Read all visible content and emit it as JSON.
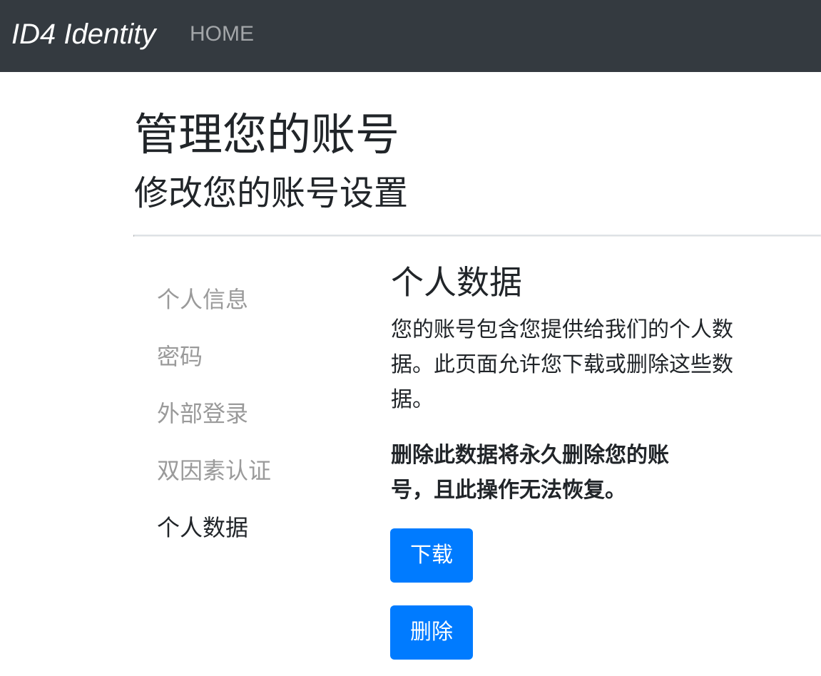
{
  "navbar": {
    "brand": "ID4 Identity",
    "home": "HOME"
  },
  "header": {
    "title": "管理您的账号",
    "subtitle": "修改您的账号设置"
  },
  "sidebar": {
    "items": [
      {
        "label": "个人信息",
        "active": false
      },
      {
        "label": "密码",
        "active": false
      },
      {
        "label": "外部登录",
        "active": false
      },
      {
        "label": "双因素认证",
        "active": false
      },
      {
        "label": "个人数据",
        "active": true
      }
    ]
  },
  "main": {
    "title": "个人数据",
    "intro": "您的账号包含您提供给我们的个人数据。此页面允许您下载或删除这些数据。",
    "warning": "删除此数据将永久删除您的账号，且此操作无法恢复。",
    "download_label": "下载",
    "delete_label": "删除"
  },
  "colors": {
    "navbar_bg": "#343a40",
    "primary": "#007bff",
    "inactive_link": "#9a9a9a"
  }
}
